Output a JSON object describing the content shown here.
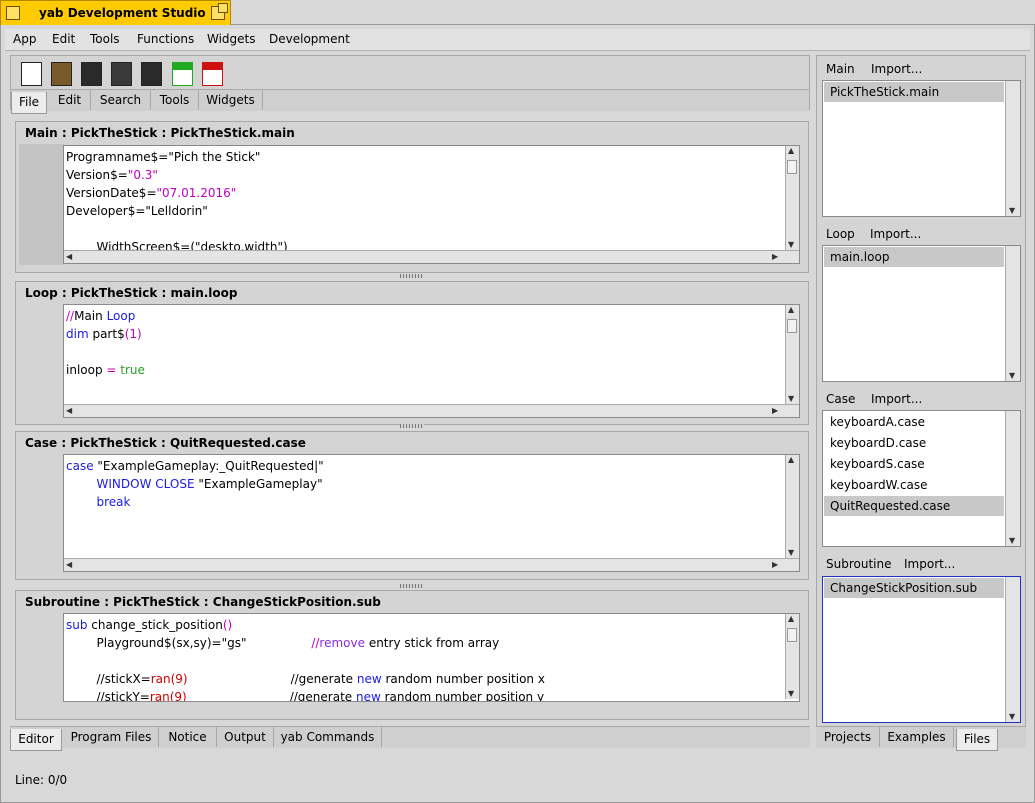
{
  "window": {
    "title": "yab Development Studio"
  },
  "menu": [
    "App",
    "Edit",
    "Tools",
    "Functions",
    "Widgets",
    "Development"
  ],
  "toolbar": {
    "icons": [
      {
        "name": "new-file-icon",
        "color": "#ffffff"
      },
      {
        "name": "open-folder-icon",
        "color": "#7a5a2a"
      },
      {
        "name": "save-icon",
        "color": "#2a2a2a"
      },
      {
        "name": "save-as-icon",
        "color": "#2a2a2a"
      },
      {
        "name": "save-all-icon",
        "color": "#2a2a2a"
      },
      {
        "name": "export-html-icon",
        "color": "#1faa1f"
      },
      {
        "name": "export-pdf-icon",
        "color": "#d01010"
      }
    ],
    "tabs": [
      "File",
      "Edit",
      "Search",
      "Tools",
      "Widgets"
    ],
    "active_tab": "File"
  },
  "sections": [
    {
      "title": "Main : PickTheStick : PickTheStick.main",
      "lines": [
        [
          {
            "t": "Programname$=",
            "c": ""
          },
          {
            "t": "\"Pich the Stick\"",
            "c": ""
          }
        ],
        [
          {
            "t": "Version$=",
            "c": ""
          },
          {
            "t": "\"0.3\"",
            "c": "kw-mag"
          }
        ],
        [
          {
            "t": "VersionDate$=",
            "c": ""
          },
          {
            "t": "\"07.01.2016\"",
            "c": "kw-mag"
          }
        ],
        [
          {
            "t": "Developer$=",
            "c": ""
          },
          {
            "t": "\"Lelldorin\"",
            "c": ""
          }
        ],
        [],
        [
          {
            "t": "        WidthScreen$=(\"deskto.width\")",
            "c": ""
          }
        ]
      ]
    },
    {
      "title": "Loop : PickTheStick : main.loop",
      "lines": [
        [
          {
            "t": "//",
            "c": "kw-mag"
          },
          {
            "t": "Main ",
            "c": ""
          },
          {
            "t": "Loop",
            "c": "kw-blue"
          }
        ],
        [
          {
            "t": "dim",
            "c": "kw-blue"
          },
          {
            "t": " part$",
            "c": ""
          },
          {
            "t": "(1)",
            "c": "kw-mag"
          }
        ],
        [],
        [
          {
            "t": "inloop ",
            "c": ""
          },
          {
            "t": "= ",
            "c": "kw-mag"
          },
          {
            "t": "true",
            "c": "kw-green"
          }
        ]
      ]
    },
    {
      "title": "Case : PickTheStick : QuitRequested.case",
      "lines": [
        [
          {
            "t": "case ",
            "c": "kw-blue"
          },
          {
            "t": "\"ExampleGameplay:_QuitRequested|\"",
            "c": ""
          }
        ],
        [
          {
            "t": "        ",
            "c": ""
          },
          {
            "t": "WINDOW CLOSE ",
            "c": "kw-blue"
          },
          {
            "t": "\"ExampleGameplay\"",
            "c": ""
          }
        ],
        [
          {
            "t": "        ",
            "c": ""
          },
          {
            "t": "break",
            "c": "kw-blue"
          }
        ]
      ]
    },
    {
      "title": "Subroutine : PickTheStick : ChangeStickPosition.sub",
      "lines": [
        [
          {
            "t": "sub ",
            "c": "kw-blue"
          },
          {
            "t": "change_stick_position",
            "c": ""
          },
          {
            "t": "()",
            "c": "kw-mag"
          }
        ],
        [
          {
            "t": "        Playground$(sx,sy)=\"gs\"                 ",
            "c": ""
          },
          {
            "t": "//",
            "c": "kw-mag"
          },
          {
            "t": "remove",
            "c": "kw-purple"
          },
          {
            "t": " entry stick from array",
            "c": ""
          }
        ],
        [],
        [
          {
            "t": "        //stickX=",
            "c": ""
          },
          {
            "t": "ran(9)",
            "c": "kw-red"
          },
          {
            "t": "                           //generate ",
            "c": ""
          },
          {
            "t": "new",
            "c": "kw-blue"
          },
          {
            "t": " random number position x",
            "c": ""
          }
        ],
        [
          {
            "t": "        //stickY=",
            "c": ""
          },
          {
            "t": "ran(9)",
            "c": "kw-red"
          },
          {
            "t": "                           //generate ",
            "c": ""
          },
          {
            "t": "new",
            "c": "kw-blue"
          },
          {
            "t": " random number position y",
            "c": ""
          }
        ]
      ]
    }
  ],
  "bottom_tabs": [
    "Editor",
    "Program Files",
    "Notice",
    "Output",
    "yab Commands"
  ],
  "status": "Line: 0/0",
  "right_panel": {
    "groups": [
      {
        "label": "Main",
        "import": "Import...",
        "items": [
          "PickTheStick.main"
        ],
        "selected": 0
      },
      {
        "label": "Loop",
        "import": "Import...",
        "items": [
          "main.loop"
        ],
        "selected": 0
      },
      {
        "label": "Case",
        "import": "Import...",
        "items": [
          "keyboardA.case",
          "keyboardD.case",
          "keyboardS.case",
          "keyboardW.case",
          "QuitRequested.case"
        ],
        "selected": 4
      },
      {
        "label": "Subroutine",
        "import": "Import...",
        "items": [
          "ChangeStickPosition.sub"
        ],
        "selected": 0
      }
    ],
    "tabs": [
      "Projects",
      "Examples",
      "Files"
    ],
    "active_tab": "Files"
  }
}
